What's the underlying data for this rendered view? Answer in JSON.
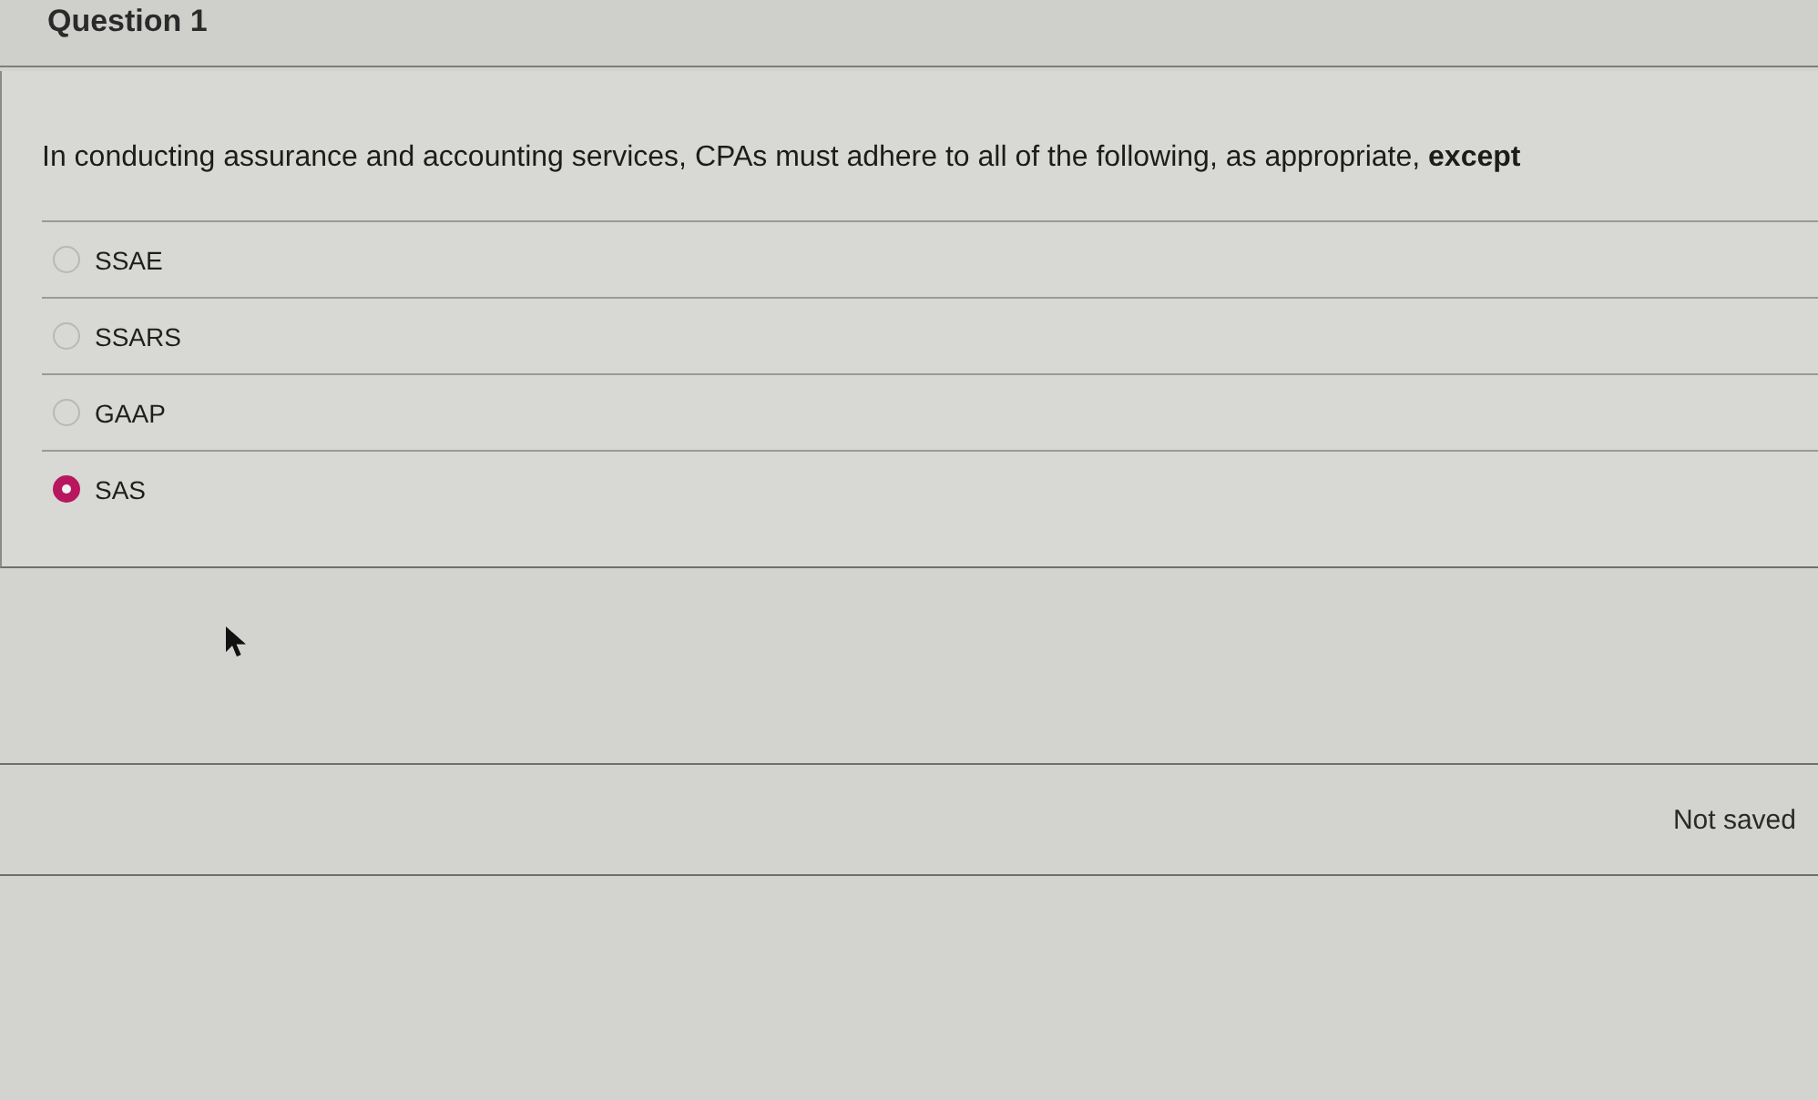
{
  "question": {
    "title": "Question 1",
    "text": "In conducting assurance and accounting services, CPAs must adhere to all of the following, as appropriate, **except**",
    "options": [
      {
        "label": "SSAE",
        "selected": false
      },
      {
        "label": "SSARS",
        "selected": false
      },
      {
        "label": "GAAP",
        "selected": false
      },
      {
        "label": "SAS",
        "selected": true
      }
    ]
  },
  "status": {
    "text": "Not saved"
  }
}
